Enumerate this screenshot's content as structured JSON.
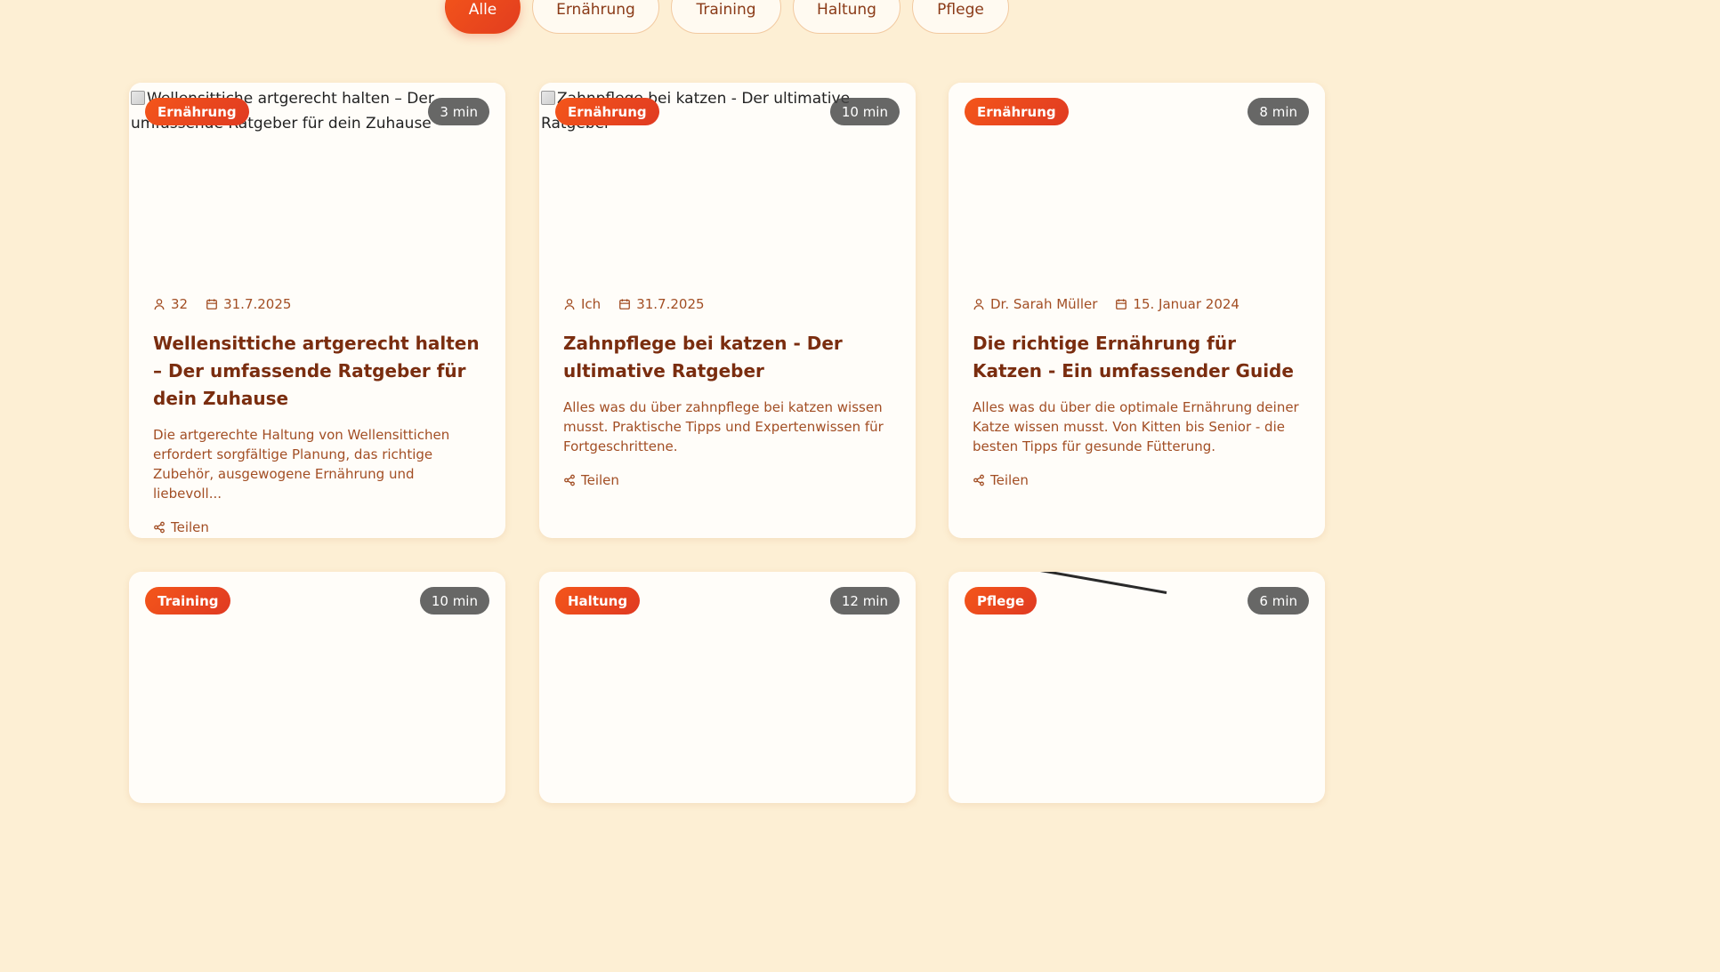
{
  "filters": [
    {
      "label": "Alle",
      "active": true
    },
    {
      "label": "Ernährung",
      "active": false
    },
    {
      "label": "Training",
      "active": false
    },
    {
      "label": "Haltung",
      "active": false
    },
    {
      "label": "Pflege",
      "active": false
    }
  ],
  "cards": [
    {
      "image_alt": "Wellensittiche artgerecht halten – Der umfassende Ratgeber für dein Zuhause",
      "image_broken": true,
      "category": "Ernährung",
      "read_time": "3 min",
      "author": "32",
      "date": "31.7.2025",
      "title": "Wellensittiche artgerecht halten – Der umfassende Ratgeber für dein Zuhause",
      "description": "Die artgerechte Haltung von Wellensittichen erfordert sorgfältige Planung, das richtige Zubehör, ausgewogene Ernährung und liebevoll...",
      "share_label": "Teilen"
    },
    {
      "image_alt": "Zahnpflege bei katzen - Der ultimative Ratgeber",
      "image_broken": true,
      "category": "Ernährung",
      "read_time": "10 min",
      "author": "Ich",
      "date": "31.7.2025",
      "title": "Zahnpflege bei katzen - Der ultimative Ratgeber",
      "description": "Alles was du über zahnpflege bei katzen wissen musst. Praktische Tipps und Expertenwissen für Fortgeschrittene.",
      "share_label": "Teilen"
    },
    {
      "image": "kitten-photo",
      "category": "Ernährung",
      "read_time": "8 min",
      "author": "Dr. Sarah Müller",
      "date": "15. Januar 2024",
      "title": "Die richtige Ernährung für Katzen - Ein umfassender Guide",
      "description": "Alles was du über die optimale Ernährung deiner Katze wissen musst. Von Kitten bis Senior - die besten Tipps für gesunde Fütterung.",
      "share_label": "Teilen"
    },
    {
      "image": "dog-photo",
      "category": "Training",
      "read_time": "10 min"
    },
    {
      "image": "rabbit-photo",
      "category": "Haltung",
      "read_time": "12 min"
    },
    {
      "image": "hummingbird-photo",
      "category": "Pflege",
      "read_time": "6 min"
    }
  ],
  "icons": {
    "author": "user-icon",
    "date": "calendar-icon",
    "share": "share-icon"
  },
  "colors": {
    "background": "#fdefd4",
    "accent": "#f0501c",
    "title": "#7a2d0f",
    "text": "#a24e24"
  }
}
